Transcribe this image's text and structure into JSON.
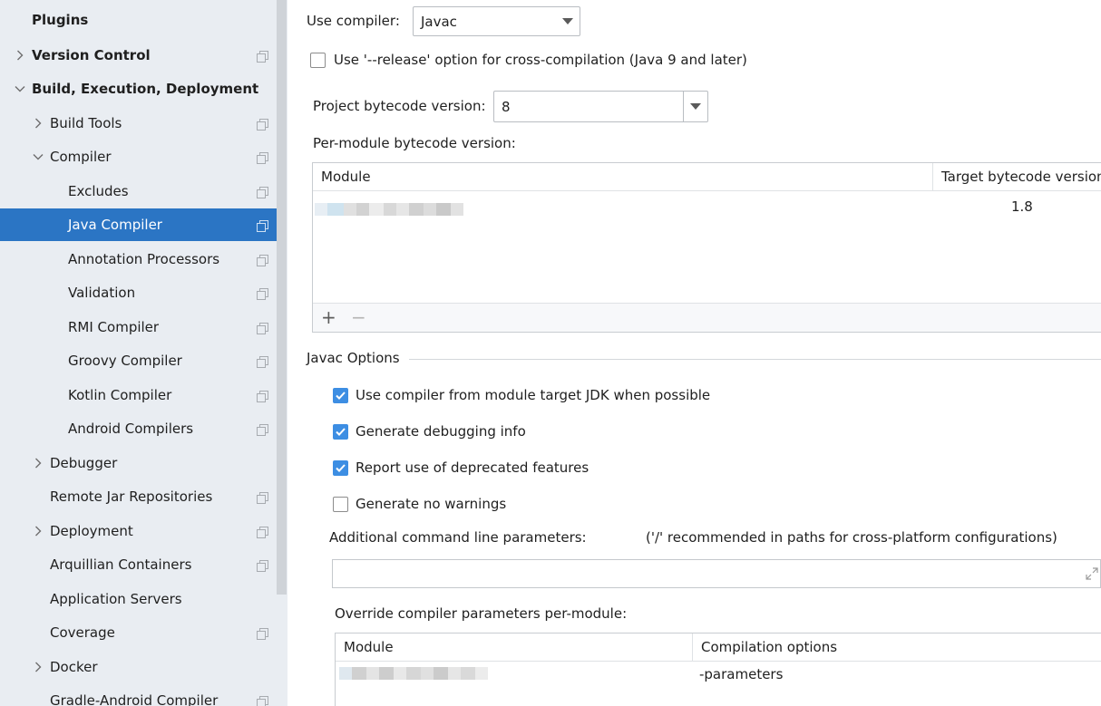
{
  "sidebar": {
    "items": [
      {
        "label": "Plugins"
      },
      {
        "label": "Version Control"
      },
      {
        "label": "Build, Execution, Deployment"
      },
      {
        "label": "Build Tools"
      },
      {
        "label": "Compiler"
      },
      {
        "label": "Excludes"
      },
      {
        "label": "Java Compiler"
      },
      {
        "label": "Annotation Processors"
      },
      {
        "label": "Validation"
      },
      {
        "label": "RMI Compiler"
      },
      {
        "label": "Groovy Compiler"
      },
      {
        "label": "Kotlin Compiler"
      },
      {
        "label": "Android Compilers"
      },
      {
        "label": "Debugger"
      },
      {
        "label": "Remote Jar Repositories"
      },
      {
        "label": "Deployment"
      },
      {
        "label": "Arquillian Containers"
      },
      {
        "label": "Application Servers"
      },
      {
        "label": "Coverage"
      },
      {
        "label": "Docker"
      },
      {
        "label": "Gradle-Android Compiler"
      }
    ],
    "selected_color": "#2b75c4"
  },
  "compiler": {
    "use_compiler_label": "Use compiler:",
    "use_compiler_value": "Javac",
    "release_option_label": "Use '--release' option for cross-compilation (Java 9 and later)",
    "project_bytecode_label": "Project bytecode version:",
    "project_bytecode_value": "8",
    "per_module_label": "Per-module bytecode version:",
    "module_table": {
      "headers": [
        "Module",
        "Target bytecode version"
      ],
      "rows": [
        {
          "target": "1.8"
        }
      ]
    },
    "add_symbol": "+",
    "remove_symbol": "−"
  },
  "javac": {
    "section_title": "Javac Options",
    "options": [
      {
        "label": "Use compiler from module target JDK when possible",
        "checked": true
      },
      {
        "label": "Generate debugging info",
        "checked": true
      },
      {
        "label": "Report use of deprecated features",
        "checked": true
      },
      {
        "label": "Generate no warnings",
        "checked": false
      }
    ],
    "additional_label": "Additional command line parameters:",
    "additional_hint": "('/' recommended in paths for cross-platform configurations)",
    "additional_value": "",
    "override_label": "Override compiler parameters per-module:",
    "override_table": {
      "headers": [
        "Module",
        "Compilation options"
      ],
      "rows": [
        {
          "options": "-parameters"
        }
      ]
    }
  },
  "colors": {
    "accent": "#3d8ee3",
    "sidebar_bg": "#e9edf2"
  }
}
